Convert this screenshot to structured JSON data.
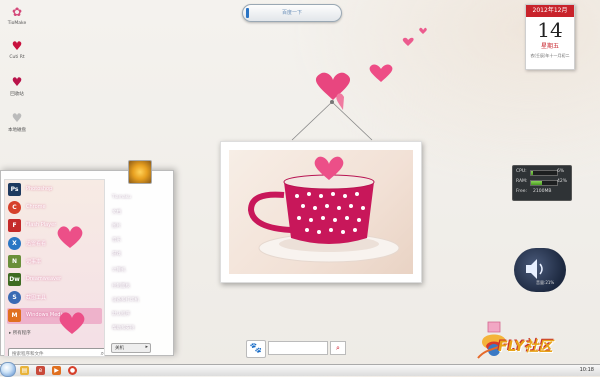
{
  "desktop": {
    "icons": [
      {
        "label": "TioMake",
        "glyph": "✿",
        "color": "#d44a7a"
      },
      {
        "label": "Cuti Rt",
        "glyph": "♥",
        "color": "#c8113d"
      },
      {
        "label": "回收站",
        "glyph": "♥",
        "color": "#b9134a"
      },
      {
        "label": "本地磁盘",
        "glyph": "♥",
        "color": "#bbbbbb"
      }
    ]
  },
  "top_search": {
    "label": "百度一下"
  },
  "calendar": {
    "header": "2012年12月",
    "day": "14",
    "weekday": "星期五",
    "lunar": "农(壬辰)年十一月初二"
  },
  "system_monitor": {
    "cpu_label": "CPU:",
    "cpu_pct": 0.07,
    "cpu_text": "6%",
    "ram_label": "RAM:",
    "ram_pct": 0.42,
    "ram_text": "42%",
    "free_label": "Free:",
    "free_value": "2100MB"
  },
  "volume": {
    "label": "音量:21%"
  },
  "start_menu": {
    "programs": [
      {
        "name": "Photoshop",
        "icon": "Ps",
        "color": "#1e3a5f"
      },
      {
        "name": "Chrome",
        "icon": "C",
        "color": "#d6402b"
      },
      {
        "name": "Flash Player",
        "icon": "F",
        "color": "#c42a2a"
      },
      {
        "name": "迅雷看看",
        "icon": "X",
        "color": "#2a76c4"
      },
      {
        "name": "记事本",
        "icon": "N",
        "color": "#6a8f3a"
      },
      {
        "name": "Dreamweaver",
        "icon": "Dw",
        "color": "#3e6b22"
      },
      {
        "name": "截图工具",
        "icon": "S",
        "color": "#3a6ab4"
      },
      {
        "name": "Windows Media",
        "icon": "M",
        "color": "#e07020"
      }
    ],
    "all_programs": "所有程序",
    "search_placeholder": "搜索程序和文件",
    "right_links": [
      "Tiamaku",
      "文档",
      "图片",
      "音乐",
      "游戏",
      "计算机",
      "控制面板",
      "设备和打印机",
      "默认程序",
      "帮助和支持"
    ],
    "shutdown": "关机"
  },
  "baidu": {
    "logo": "du",
    "placeholder": ""
  },
  "taskbar": {
    "clock": "10:18",
    "items": [
      {
        "name": "explorer",
        "color": "#e8b33a"
      },
      {
        "name": "browser",
        "color": "#c94a3a"
      },
      {
        "name": "media",
        "color": "#e07020"
      },
      {
        "name": "chrome",
        "color": "#d6402b"
      }
    ]
  },
  "watermark": {
    "text": "FLY社区"
  },
  "colors": {
    "accent": "#e64f8c",
    "calendar_red": "#c8232b"
  }
}
